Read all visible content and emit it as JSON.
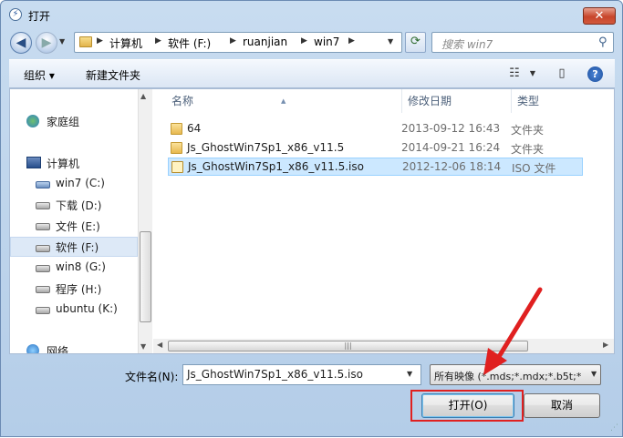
{
  "window": {
    "title": "打开",
    "close_glyph": "✕"
  },
  "nav": {
    "back_glyph": "◀",
    "forward_glyph": "▶",
    "breadcrumb": [
      "计算机",
      "软件 (F:)",
      "ruanjian",
      "win7"
    ],
    "search_placeholder": "搜索 win7"
  },
  "toolbar": {
    "organize_label": "组织 ▾",
    "new_folder_label": "新建文件夹"
  },
  "sidebar": {
    "items": [
      {
        "label": "家庭组",
        "icon": "homegroup-icon"
      },
      {
        "label": "计算机",
        "icon": "computer-icon"
      },
      {
        "label": "win7 (C:)",
        "icon": "drive-icon"
      },
      {
        "label": "下载 (D:)",
        "icon": "drive-icon"
      },
      {
        "label": "文件 (E:)",
        "icon": "drive-icon"
      },
      {
        "label": "软件 (F:)",
        "icon": "drive-icon"
      },
      {
        "label": "win8 (G:)",
        "icon": "drive-icon"
      },
      {
        "label": "程序 (H:)",
        "icon": "drive-icon"
      },
      {
        "label": "ubuntu (K:)",
        "icon": "drive-icon"
      },
      {
        "label": "网络",
        "icon": "network-icon"
      }
    ],
    "selected": "软件 (F:)"
  },
  "files": {
    "columns": [
      "名称",
      "修改日期",
      "类型"
    ],
    "rows": [
      {
        "name": "64",
        "date": "2013-09-12 16:43",
        "type": "文件夹",
        "icon": "folder-icon"
      },
      {
        "name": "Js_GhostWin7Sp1_x86_v11.5",
        "date": "2014-09-21 16:24",
        "type": "文件夹",
        "icon": "folder-icon"
      },
      {
        "name": "Js_GhostWin7Sp1_x86_v11.5.iso",
        "date": "2012-12-06 18:14",
        "type": "ISO 文件",
        "icon": "iso-file-icon"
      }
    ],
    "selected_row": 2
  },
  "footer": {
    "filename_label": "文件名(N):",
    "filename_value": "Js_GhostWin7Sp1_x86_v11.5.iso",
    "filetype_value": "所有映像 (*.mds;*.mdx;*.b5t;*",
    "open_label": "打开(O)",
    "cancel_label": "取消"
  },
  "colors": {
    "annotation": "#e02020",
    "selection": "#cce8ff"
  }
}
